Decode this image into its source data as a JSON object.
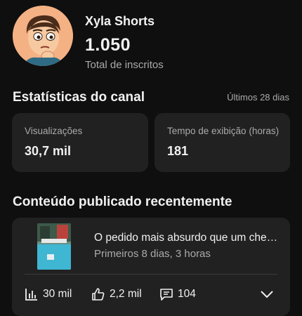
{
  "channel": {
    "name": "Xyla Shorts",
    "subscriber_count": "1.050",
    "subscriber_label": "Total de inscritos",
    "avatar_icon": "cartoon-avatar-icon"
  },
  "stats": {
    "title": "Estatísticas do canal",
    "period": "Últimos 28 dias",
    "cards": [
      {
        "label": "Visualizações",
        "value": "30,7 mil"
      },
      {
        "label": "Tempo de exibição (horas)",
        "value": "181"
      }
    ]
  },
  "recent": {
    "title": "Conteúdo publicado recentemente",
    "video": {
      "title": "O pedido mais absurdo que um chef recebeu",
      "subtitle": "Primeiros 8 dias, 3 horas",
      "metrics": {
        "views": "30 mil",
        "likes": "2,2 mil",
        "comments": "104"
      },
      "icons": [
        "bar-chart-icon",
        "thumbs-up-icon",
        "comment-icon",
        "chevron-down-icon"
      ]
    }
  },
  "colors": {
    "background": "#0f0f0f",
    "card": "#212121",
    "text_primary": "#f1f1f1",
    "text_secondary": "#aaaaaa"
  }
}
